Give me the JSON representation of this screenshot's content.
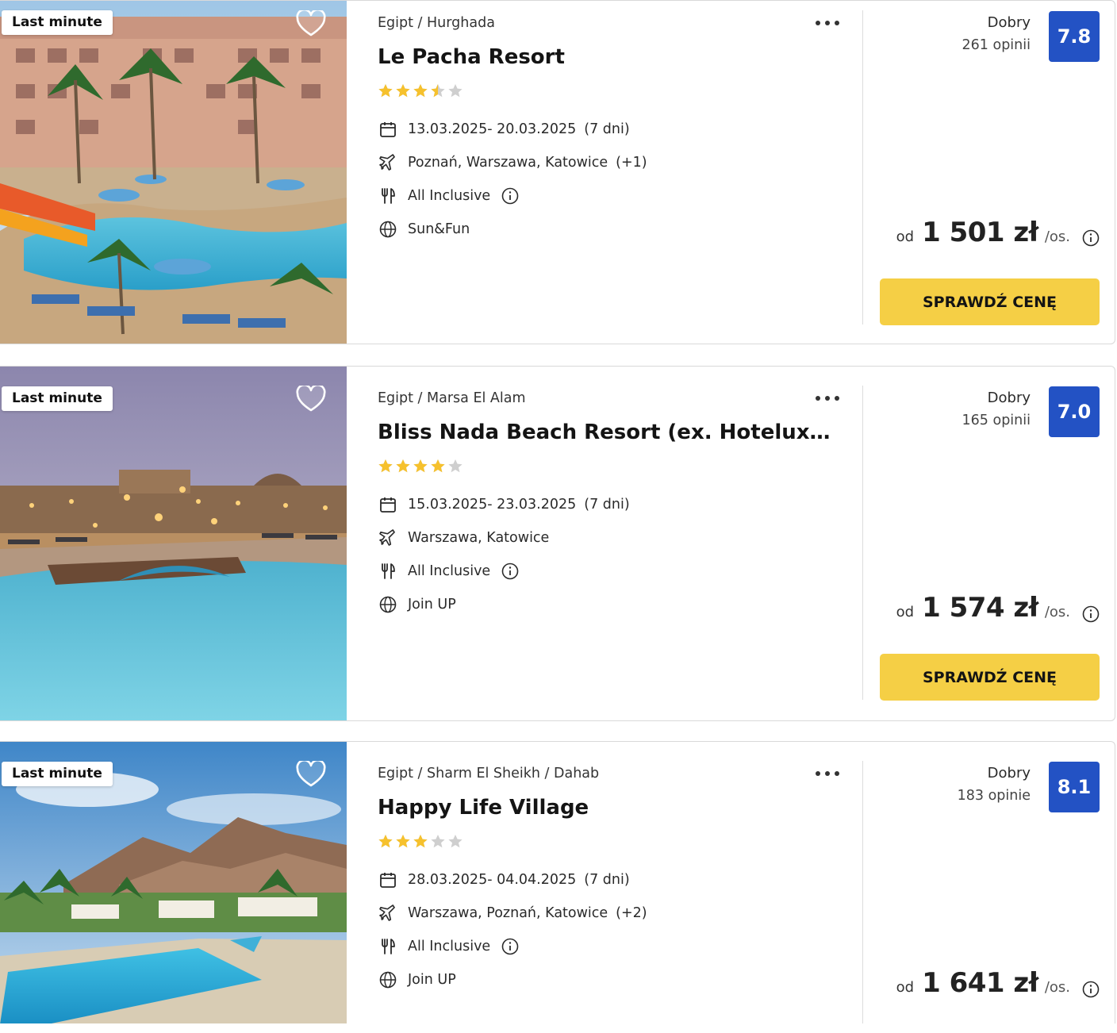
{
  "offers": [
    {
      "badge": "Last minute",
      "breadcrumb": "Egipt / Hurghada",
      "name": "Le Pacha Resort",
      "stars": 3.5,
      "dates": "13.03.2025- 20.03.2025",
      "duration": "(7 dni)",
      "departures": "Poznań, Warszawa, Katowice",
      "departures_extra": "(+1)",
      "board": "All Inclusive",
      "concept": "Sun&Fun",
      "rating_label": "Dobry",
      "reviews": "261 opinii",
      "score": "7.8",
      "price_prefix": "od",
      "price": "1 501 zł",
      "price_unit": "/os.",
      "cta": "SPRAWDŹ CENĘ"
    },
    {
      "badge": "Last minute",
      "breadcrumb": "Egipt / Marsa El Alam",
      "name": "Bliss Nada Beach Resort (ex. Hotelux J…",
      "stars": 4,
      "dates": "15.03.2025- 23.03.2025",
      "duration": "(7 dni)",
      "departures": "Warszawa, Katowice",
      "departures_extra": "",
      "board": "All Inclusive",
      "concept": "Join UP",
      "rating_label": "Dobry",
      "reviews": "165 opinii",
      "score": "7.0",
      "price_prefix": "od",
      "price": "1 574 zł",
      "price_unit": "/os.",
      "cta": "SPRAWDŹ CENĘ"
    },
    {
      "badge": "Last minute",
      "breadcrumb": "Egipt / Sharm El Sheikh / Dahab",
      "name": "Happy Life Village",
      "stars": 3,
      "dates": "28.03.2025- 04.04.2025",
      "duration": "(7 dni)",
      "departures": "Warszawa, Poznań, Katowice",
      "departures_extra": "(+2)",
      "board": "All Inclusive",
      "concept": "Join UP",
      "rating_label": "Dobry",
      "reviews": "183 opinie",
      "score": "8.1",
      "price_prefix": "od",
      "price": "1 641 zł",
      "price_unit": "/os.",
      "cta": "SPRAWDŹ CENĘ"
    }
  ],
  "colors": {
    "score_bg": "#2352c4",
    "cta_bg": "#f5cf45",
    "star_on": "#f6c12d",
    "star_off": "#cfcfcf"
  }
}
